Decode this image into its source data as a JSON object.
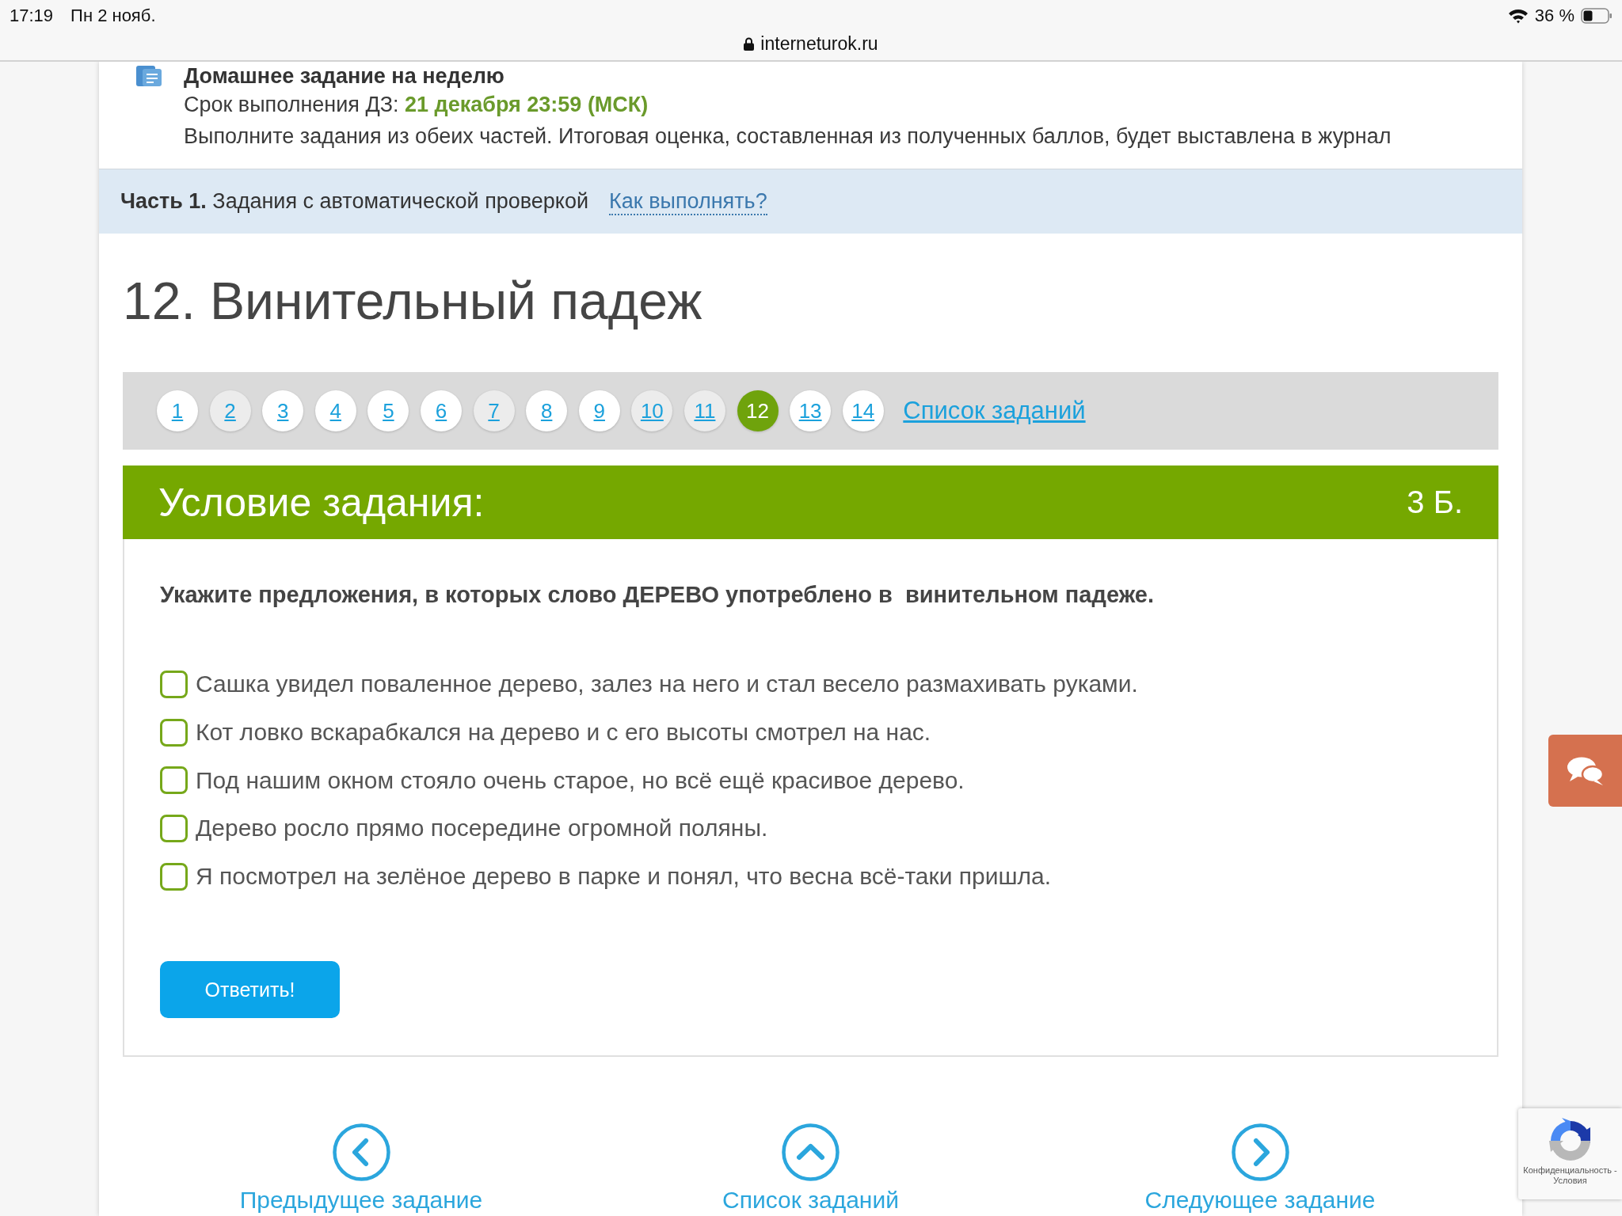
{
  "status_bar": {
    "time": "17:19",
    "date": "Пн 2 нояб.",
    "battery": "36 %"
  },
  "address_bar": {
    "url": "interneturok.ru"
  },
  "homework": {
    "title": "Домашнее задание на неделю",
    "deadline": "Срок выполнения ДЗ: **21 декабря 23:59 (МСК)**",
    "note": "Выполните задания из обеих частей. Итоговая оценка, составленная из полученных баллов, будет выставлена в журнал"
  },
  "part": {
    "text": "**Часть 1.** Задания с автоматической проверкой",
    "help_link": "Как выполнять?"
  },
  "task_title": "12. Винительный падеж",
  "pagination": {
    "pages": [
      {
        "label": "1",
        "selected": false,
        "visited": false
      },
      {
        "label": "2",
        "selected": false,
        "visited": true
      },
      {
        "label": "3",
        "selected": false,
        "visited": false
      },
      {
        "label": "4",
        "selected": false,
        "visited": false
      },
      {
        "label": "5",
        "selected": false,
        "visited": false
      },
      {
        "label": "6",
        "selected": false,
        "visited": false
      },
      {
        "label": "7",
        "selected": false,
        "visited": true
      },
      {
        "label": "8",
        "selected": false,
        "visited": false
      },
      {
        "label": "9",
        "selected": false,
        "visited": false
      },
      {
        "label": "10",
        "selected": false,
        "visited": true
      },
      {
        "label": "11",
        "selected": false,
        "visited": true
      },
      {
        "label": "12",
        "selected": true,
        "visited": false
      },
      {
        "label": "13",
        "selected": false,
        "visited": false
      },
      {
        "label": "14",
        "selected": false,
        "visited": false
      }
    ],
    "list_link": "Список заданий"
  },
  "task": {
    "header": "Условие задания:",
    "points": "3 Б.",
    "question": "Укажите предложения, в которых слово ДЕРЕВО употреблено в  винительном падеже.",
    "options": [
      {
        "text": "Сашка увидел поваленное дерево, залез на него и стал весело размахивать руками.",
        "checked": false
      },
      {
        "text": "Кот ловко вскарабкался на дерево и с его высоты смотрел на нас.",
        "checked": false
      },
      {
        "text": "Под нашим окном стояло очень старое, но всё ещё красивое дерево.",
        "checked": false
      },
      {
        "text": "Дерево росло прямо посередине огромной поляны.",
        "checked": false
      },
      {
        "text": "Я посмотрел на зелёное дерево в парке и понял, что весна всё-таки пришла.",
        "checked": false
      }
    ],
    "submit": "Ответить!"
  },
  "bottom_nav": [
    {
      "kind": "prev",
      "label": "Предыдущее задание"
    },
    {
      "kind": "up",
      "label": "Список заданий"
    },
    {
      "kind": "next",
      "label": "Следующее задание"
    }
  ],
  "recaptcha": {
    "privacy": "Конфиденциальность -",
    "terms": "Условия"
  }
}
